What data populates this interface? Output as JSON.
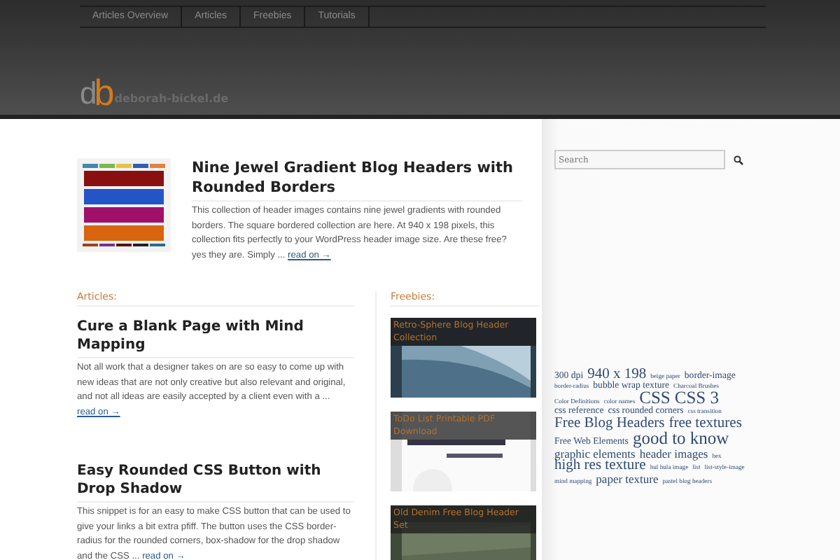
{
  "nav": [
    {
      "label": "Articles Overview"
    },
    {
      "label": "Articles"
    },
    {
      "label": "Freebies"
    },
    {
      "label": "Tutorials"
    }
  ],
  "logo": {
    "mark_light": "d",
    "mark_accent": "b",
    "site": "deborah-bickel.de"
  },
  "featured": {
    "title": "Nine Jewel Gradient Blog Headers with Rounded Borders",
    "excerpt": "This collection of header images contains nine jewel gradients with rounded borders. The square bordered collection are here. At 940 x 198 pixels, this collection fits perfectly to your WordPress header image size. Are these free? yes they are. Simply ...",
    "link": "read on →"
  },
  "articles": {
    "heading": "Articles:",
    "posts": [
      {
        "title": "Cure a Blank Page with Mind Mapping",
        "excerpt": "Not all work that a designer takes on are so easy to come up with new ideas that are not only creative but also relevant and original, and not all ideas are easily accepted by a client even with a ...",
        "link": "read on →"
      },
      {
        "title": "Easy Rounded CSS Button with Drop Shadow",
        "excerpt": "This snippet is for an easy to make CSS button that can be used to give your links a bit extra pfiff. The button uses the CSS border-radius for the rounded corners, box-shadow for the drop shadow and the CSS ...",
        "link": "read on →"
      }
    ]
  },
  "freebies": {
    "heading": "Freebies:",
    "items": [
      {
        "title": "Retro-Sphere Blog Header Collection",
        "kind": "picture"
      },
      {
        "title": "ToDo List Printable PDF Download",
        "kind": "picture"
      },
      {
        "title": "Old Denim Free Blog Header Set",
        "kind": "picture"
      }
    ]
  },
  "sidebar": {
    "search": {
      "placeholder": "Search"
    },
    "tags": [
      {
        "label": "300 dpi",
        "kind": "small"
      },
      {
        "label": "940 x 198",
        "kind": "large"
      },
      {
        "label": "beige paper",
        "kind": "tiny"
      },
      {
        "label": "border-image",
        "kind": "small"
      },
      {
        "label": "border-radius",
        "kind": "tiny"
      },
      {
        "label": "bubble wrap texture",
        "kind": "small"
      },
      {
        "label": "Charcoal Brushes",
        "kind": "tiny"
      },
      {
        "label": "Color Definitions",
        "kind": "tiny"
      },
      {
        "label": "color names",
        "kind": "tiny"
      },
      {
        "label": "CSS",
        "kind": "huge"
      },
      {
        "label": "CSS 3",
        "kind": "huge"
      },
      {
        "label": "css reference",
        "kind": "small"
      },
      {
        "label": "css rounded corners",
        "kind": "small"
      },
      {
        "label": "css transition",
        "kind": "tiny"
      },
      {
        "label": "Free Blog Headers",
        "kind": "large"
      },
      {
        "label": "free textures",
        "kind": "large"
      },
      {
        "label": "Free Web Elements",
        "kind": "small"
      },
      {
        "label": "good to know",
        "kind": "huge"
      },
      {
        "label": "graphic elements",
        "kind": "medium"
      },
      {
        "label": "header images",
        "kind": "medium"
      },
      {
        "label": "hex",
        "kind": "tiny"
      },
      {
        "label": "high res texture",
        "kind": "large"
      },
      {
        "label": "hul hula image",
        "kind": "tiny"
      },
      {
        "label": "list",
        "kind": "tiny"
      },
      {
        "label": "list-style-image",
        "kind": "tiny"
      },
      {
        "label": "mind mapping",
        "kind": "tiny"
      },
      {
        "label": "paper texture",
        "kind": "medium"
      },
      {
        "label": "pastel blog headers",
        "kind": "tiny"
      }
    ]
  }
}
